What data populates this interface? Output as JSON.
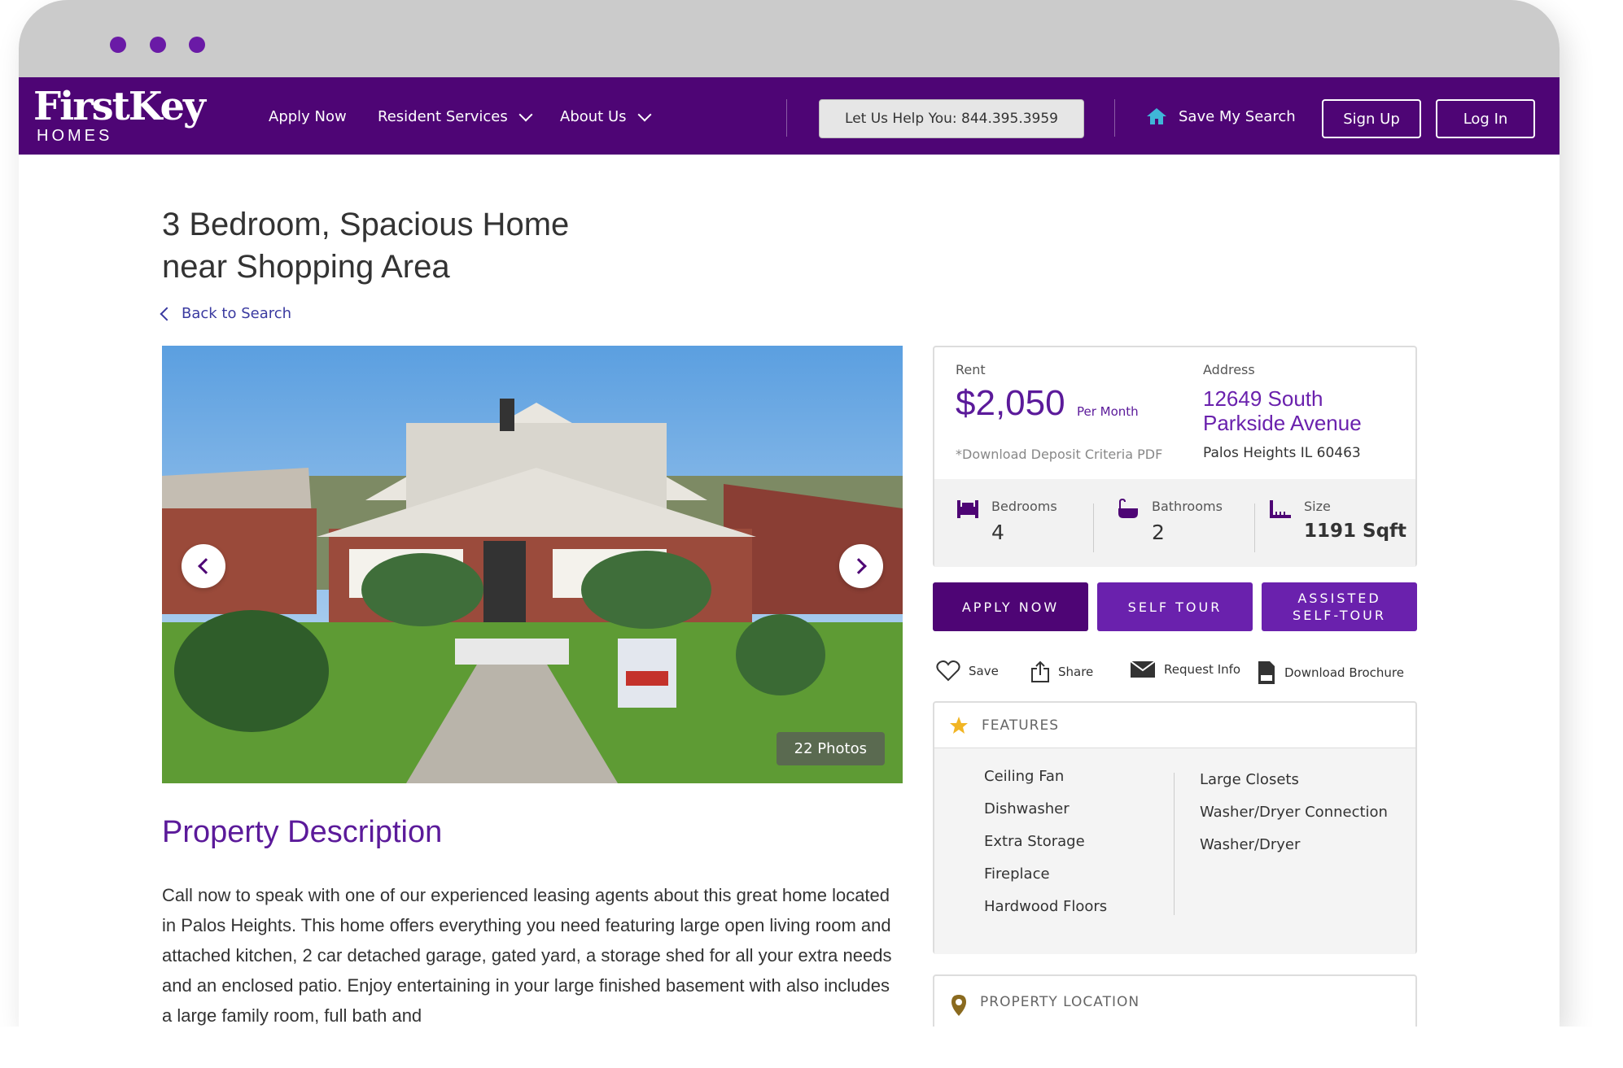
{
  "nav": {
    "logo_brand": "FirstKey",
    "logo_sub": "HOMES",
    "apply": "Apply Now",
    "resident": "Resident Services",
    "about": "About Us",
    "help": "Let Us Help You:  844.395.3959",
    "save_search": "Save My Search",
    "signup": "Sign Up",
    "login": "Log In"
  },
  "listing": {
    "title_line1": "3 Bedroom, Spacious Home",
    "title_line2": "near Shopping Area",
    "back": "Back to Search",
    "photos": "22 Photos"
  },
  "info": {
    "rent_label": "Rent",
    "rent_value": "$2,050",
    "per_month": "Per Month",
    "deposit": "*Download Deposit Criteria PDF",
    "address_label": "Address",
    "address_line1": "12649 South",
    "address_line2": "Parkside Avenue",
    "city": "Palos Heights IL 60463",
    "bed_label": "Bedrooms",
    "bed_value": "4",
    "bath_label": "Bathrooms",
    "bath_value": "2",
    "size_label": "Size",
    "size_value": "1191 Sqft"
  },
  "cta": {
    "apply": "APPLY NOW",
    "self_tour": "SELF TOUR",
    "assisted_1": "ASSISTED",
    "assisted_2": "SELF-TOUR"
  },
  "actions": {
    "save": "Save",
    "share": "Share",
    "request": "Request Info",
    "brochure": "Download Brochure"
  },
  "features": {
    "title": "FEATURES",
    "left": [
      "Ceiling Fan",
      "Dishwasher",
      "Extra Storage",
      "Fireplace",
      "Hardwood Floors"
    ],
    "right": [
      "Large Closets",
      "Washer/Dryer Connection",
      "Washer/Dryer"
    ]
  },
  "location": {
    "title": "PROPERTY LOCATION"
  },
  "description": {
    "heading": "Property Description",
    "body": "Call now to speak with one of our experienced leasing agents about this great home located in Palos Heights. This home offers everything you need featuring large open living room and attached kitchen, 2 car detached garage, gated yard, a storage shed for all your extra needs and an enclosed patio. Enjoy entertaining in your large finished basement with also includes a large family room, full bath and"
  },
  "colors": {
    "nav": "#4e0575",
    "accent": "#5b1a9a",
    "cta_dark": "#4e0575",
    "cta_mid": "#6a21ad"
  }
}
